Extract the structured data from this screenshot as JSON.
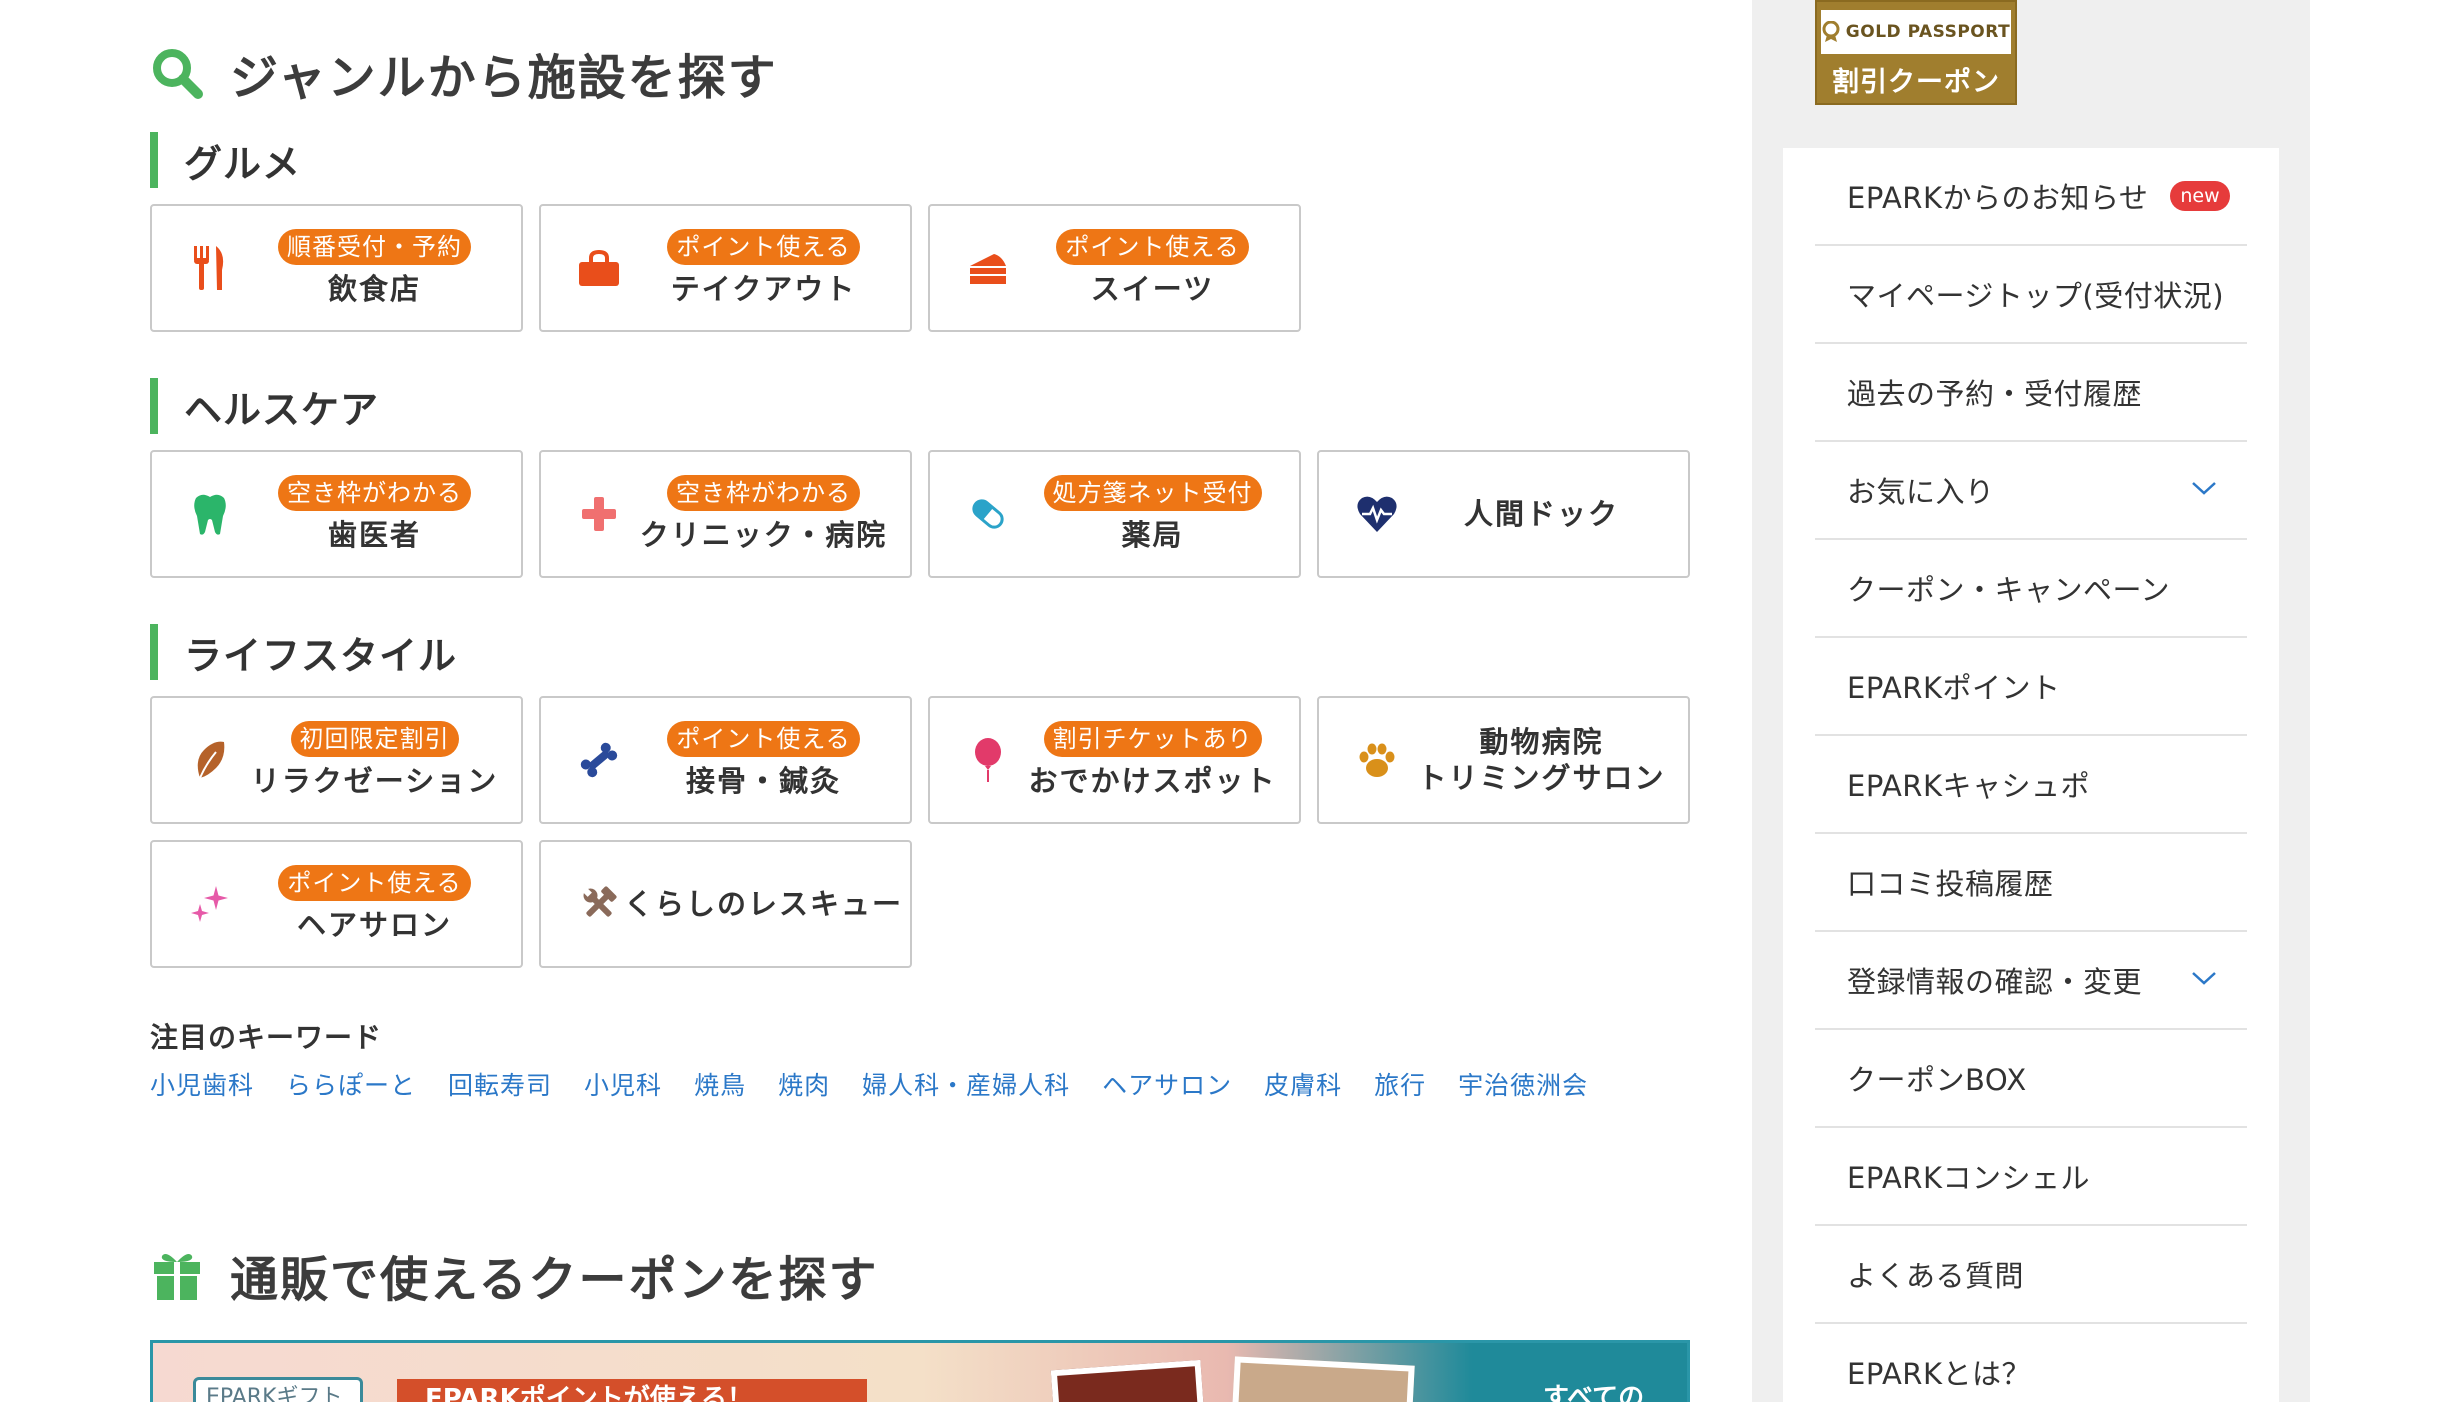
{
  "genre_section": {
    "title": "ジャンルから施設を探す"
  },
  "categories": {
    "gourmet": {
      "title": "グルメ",
      "cards": [
        {
          "badge": "順番受付・予約",
          "name": "飲食店",
          "icon": "fork-knife-icon",
          "color": "#e94e1b"
        },
        {
          "badge": "ポイント使える",
          "name": "テイクアウト",
          "icon": "bag-icon",
          "color": "#e94e1b"
        },
        {
          "badge": "ポイント使える",
          "name": "スイーツ",
          "icon": "cake-icon",
          "color": "#e94e1b"
        }
      ]
    },
    "health": {
      "title": "ヘルスケア",
      "cards": [
        {
          "badge": "空き枠がわかる",
          "name": "歯医者",
          "icon": "tooth-icon",
          "color": "#2bb56a"
        },
        {
          "badge": "空き枠がわかる",
          "name": "クリニック・病院",
          "icon": "medical-cross-icon",
          "color": "#f07070"
        },
        {
          "badge": "処方箋ネット受付",
          "name": "薬局",
          "icon": "pill-icon",
          "color": "#2ba3c9"
        },
        {
          "badge": "",
          "name": "人間ドック",
          "icon": "heart-pulse-icon",
          "color": "#1e2f6e"
        }
      ]
    },
    "lifestyle": {
      "title": "ライフスタイル",
      "cards": [
        {
          "badge": "初回限定割引",
          "name": "リラクゼーション",
          "icon": "leaf-icon",
          "color": "#b5622a"
        },
        {
          "badge": "ポイント使える",
          "name": "接骨・鍼灸",
          "icon": "bone-icon",
          "color": "#2a4a9a"
        },
        {
          "badge": "割引チケットあり",
          "name": "おでかけスポット",
          "icon": "balloon-icon",
          "color": "#e23a6a"
        },
        {
          "badge": "",
          "name_line1": "動物病院",
          "name_line2": "トリミングサロン",
          "icon": "paw-icon",
          "color": "#d9901a"
        },
        {
          "badge": "ポイント使える",
          "name": "ヘアサロン",
          "icon": "sparkle-icon",
          "color": "#e65aa8"
        },
        {
          "badge": "",
          "name": "くらしのレスキュー",
          "icon": "tools-icon",
          "color": "#8a6a5a"
        }
      ]
    }
  },
  "keywords": {
    "title": "注目のキーワード",
    "items": [
      "小児歯科",
      "ららぽーと",
      "回転寿司",
      "小児科",
      "焼鳥",
      "焼肉",
      "婦人科・産婦人科",
      "ヘアサロン",
      "皮膚科",
      "旅行",
      "宇治徳洲会"
    ]
  },
  "tsuhan_section": {
    "title": "通販で使えるクーポンを探す"
  },
  "banner": {
    "label": "EPARKギフト",
    "ribbon": "EPARKポイントが使える！",
    "more": "すべての"
  },
  "gold_passport": {
    "top": "GOLD PASSPORT",
    "bottom": "割引クーポン"
  },
  "sidebar_menu": [
    {
      "label": "EPARKからのお知らせ",
      "badge": "new"
    },
    {
      "label": "マイページトップ(受付状況)"
    },
    {
      "label": "過去の予約・受付履歴"
    },
    {
      "label": "お気に入り",
      "expandable": true
    },
    {
      "label": "クーポン・キャンペーン"
    },
    {
      "label": "EPARKポイント"
    },
    {
      "label": "EPARKキャシュポ"
    },
    {
      "label": "口コミ投稿履歴"
    },
    {
      "label": "登録情報の確認・変更",
      "expandable": true
    },
    {
      "label": "クーポンBOX"
    },
    {
      "label": "EPARKコンシェル"
    },
    {
      "label": "よくある質問"
    },
    {
      "label": "EPARKとは？"
    }
  ],
  "colors": {
    "accent_green": "#4cb45e",
    "badge_orange": "#ee7615",
    "link_blue": "#2b78c8",
    "new_red": "#e63b3b",
    "gold": "#a07e2e"
  }
}
